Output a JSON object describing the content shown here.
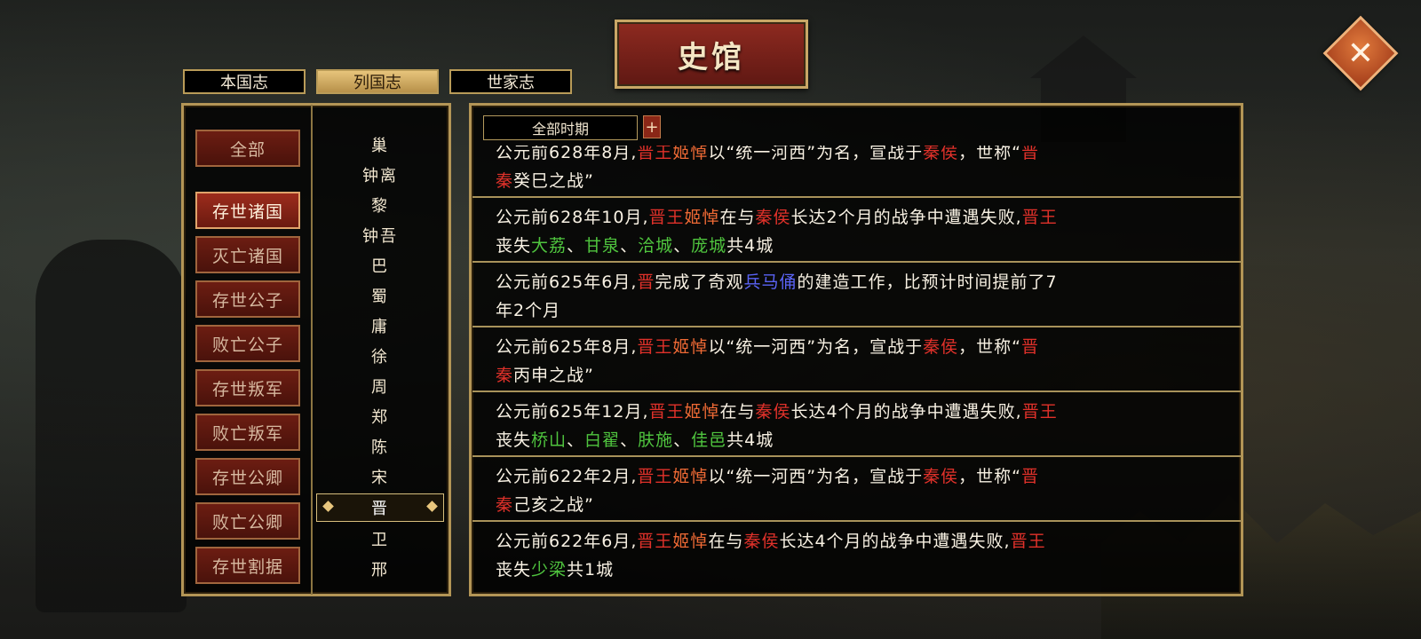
{
  "title": "史馆",
  "close_icon": "close-icon",
  "tabs": [
    "本国志",
    "列国志",
    "世家志"
  ],
  "active_tab": 1,
  "categories": {
    "all": "全部",
    "items": [
      "存世诸国",
      "灭亡诸国",
      "存世公子",
      "败亡公子",
      "存世叛军",
      "败亡叛军",
      "存世公卿",
      "败亡公卿",
      "存世割据"
    ],
    "selected": 0
  },
  "states": {
    "items": [
      "巢",
      "钟离",
      "黎",
      "钟吾",
      "巴",
      "蜀",
      "庸",
      "徐",
      "周",
      "郑",
      "陈",
      "宋",
      "晋",
      "卫",
      "邢"
    ],
    "selected": 12
  },
  "filter": {
    "period": "全部时期",
    "plus": "+"
  },
  "colors": {
    "red": "#e0312a",
    "orange": "#ef6a35",
    "green": "#4fc43e",
    "blue": "#5a63f5",
    "gold": "#b39556"
  },
  "records": [
    {
      "line1": [
        [
          "公元前628年8月,",
          ""
        ],
        [
          "晋王",
          "r"
        ],
        [
          "姬悼",
          "o"
        ],
        [
          "以“统一河西”为名，宣战于",
          ""
        ],
        [
          "秦侯",
          "r"
        ],
        [
          "，世称“",
          ""
        ],
        [
          "晋",
          "r"
        ]
      ],
      "line2": [
        [
          "秦",
          "r"
        ],
        [
          "癸巳之战”",
          ""
        ]
      ]
    },
    {
      "line1": [
        [
          "公元前628年10月,",
          ""
        ],
        [
          "晋王",
          "r"
        ],
        [
          "姬悼",
          "o"
        ],
        [
          "在与",
          ""
        ],
        [
          "秦侯",
          "r"
        ],
        [
          "长达2个月的战争中遭遇失败,",
          ""
        ],
        [
          "晋王",
          "r"
        ]
      ],
      "line2": [
        [
          "丧失",
          ""
        ],
        [
          "大荔",
          "g"
        ],
        [
          "、",
          ""
        ],
        [
          "甘泉",
          "g"
        ],
        [
          "、",
          ""
        ],
        [
          "洽城",
          "g"
        ],
        [
          "、",
          ""
        ],
        [
          "庞城",
          "g"
        ],
        [
          "共4城",
          ""
        ]
      ]
    },
    {
      "line1": [
        [
          "公元前625年6月,",
          ""
        ],
        [
          "晋",
          "r"
        ],
        [
          "完成了奇观",
          ""
        ],
        [
          "兵马俑",
          "b"
        ],
        [
          "的建造工作，比预计时间提前了7",
          ""
        ]
      ],
      "line2": [
        [
          "年2个月",
          ""
        ]
      ]
    },
    {
      "line1": [
        [
          "公元前625年8月,",
          ""
        ],
        [
          "晋王",
          "r"
        ],
        [
          "姬悼",
          "o"
        ],
        [
          "以“统一河西”为名，宣战于",
          ""
        ],
        [
          "秦侯",
          "r"
        ],
        [
          "，世称“",
          ""
        ],
        [
          "晋",
          "r"
        ]
      ],
      "line2": [
        [
          "秦",
          "r"
        ],
        [
          "丙申之战”",
          ""
        ]
      ]
    },
    {
      "line1": [
        [
          "公元前625年12月,",
          ""
        ],
        [
          "晋王",
          "r"
        ],
        [
          "姬悼",
          "o"
        ],
        [
          "在与",
          ""
        ],
        [
          "秦侯",
          "r"
        ],
        [
          "长达4个月的战争中遭遇失败,",
          ""
        ],
        [
          "晋王",
          "r"
        ]
      ],
      "line2": [
        [
          "丧失",
          ""
        ],
        [
          "桥山",
          "g"
        ],
        [
          "、",
          ""
        ],
        [
          "白翟",
          "g"
        ],
        [
          "、",
          ""
        ],
        [
          "肤施",
          "g"
        ],
        [
          "、",
          ""
        ],
        [
          "佳邑",
          "g"
        ],
        [
          "共4城",
          ""
        ]
      ]
    },
    {
      "line1": [
        [
          "公元前622年2月,",
          ""
        ],
        [
          "晋王",
          "r"
        ],
        [
          "姬悼",
          "o"
        ],
        [
          "以“统一河西”为名，宣战于",
          ""
        ],
        [
          "秦侯",
          "r"
        ],
        [
          "，世称“",
          ""
        ],
        [
          "晋",
          "r"
        ]
      ],
      "line2": [
        [
          "秦",
          "r"
        ],
        [
          "己亥之战”",
          ""
        ]
      ]
    },
    {
      "line1": [
        [
          "公元前622年6月,",
          ""
        ],
        [
          "晋王",
          "r"
        ],
        [
          "姬悼",
          "o"
        ],
        [
          "在与",
          ""
        ],
        [
          "秦侯",
          "r"
        ],
        [
          "长达4个月的战争中遭遇失败,",
          ""
        ],
        [
          "晋王",
          "r"
        ]
      ],
      "line2": [
        [
          "丧失",
          ""
        ],
        [
          "少梁",
          "g"
        ],
        [
          "共1城",
          ""
        ]
      ]
    }
  ]
}
